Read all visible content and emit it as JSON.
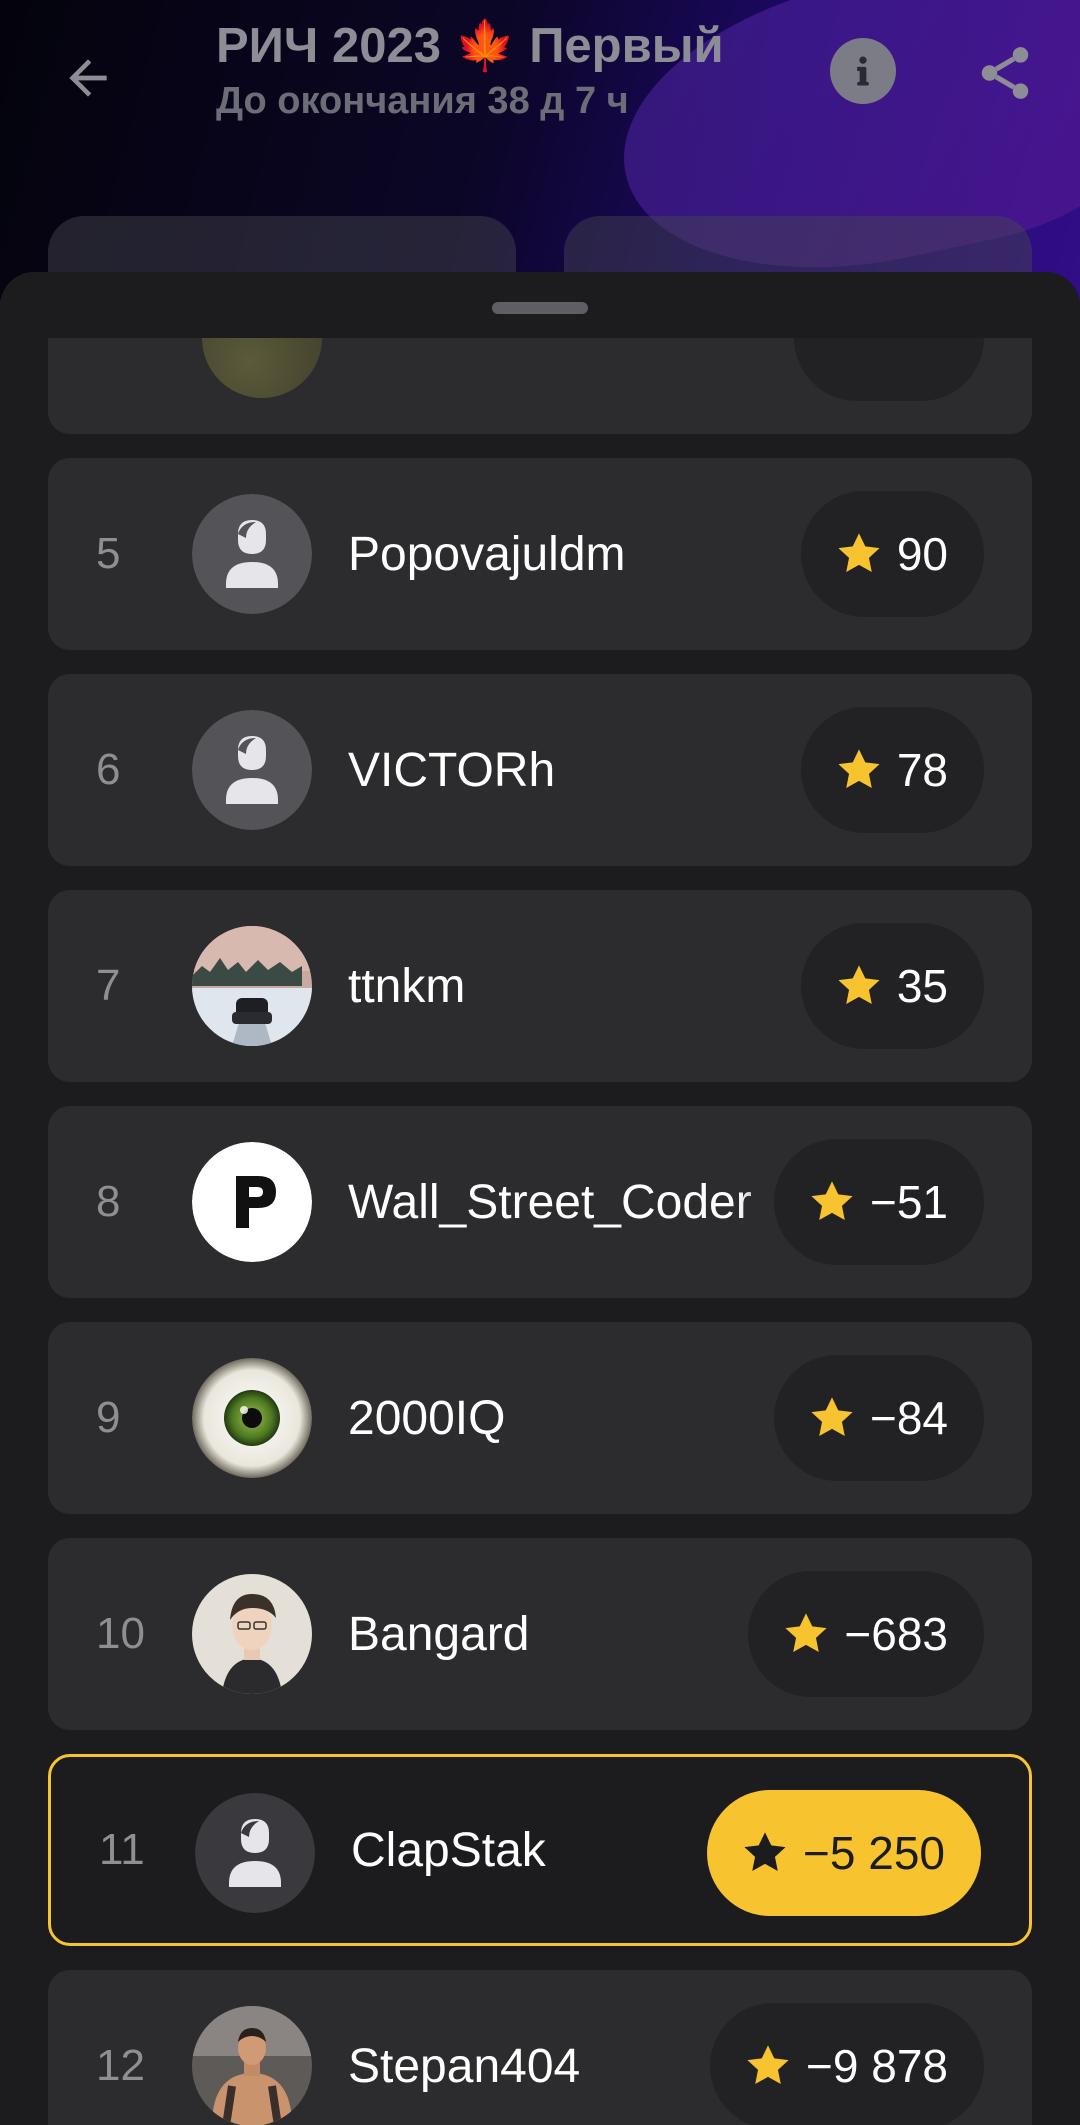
{
  "header": {
    "title": "РИЧ 2023 🍁 Первый",
    "subtitle": "До окончания 38 д 7 ч",
    "back_icon": "arrow-back-icon",
    "info_icon": "info-icon",
    "share_icon": "share-icon"
  },
  "colors": {
    "accent": "#f7c430",
    "card": "#2c2c2e",
    "background": "#1c1c1e"
  },
  "leaderboard": [
    {
      "rank": "5",
      "name": "Popovajuldm",
      "score": "90",
      "avatar": "default-user-icon"
    },
    {
      "rank": "6",
      "name": "VICTORh",
      "score": "78",
      "avatar": "default-user-icon"
    },
    {
      "rank": "7",
      "name": "ttnkm",
      "score": "35",
      "avatar": "photo-car-winter"
    },
    {
      "rank": "8",
      "name": "Wall_Street_Coder",
      "score": "−51",
      "avatar": "letter-p-logo"
    },
    {
      "rank": "9",
      "name": "2000IQ",
      "score": "−84",
      "avatar": "photo-eye"
    },
    {
      "rank": "10",
      "name": "Bangard",
      "score": "−683",
      "avatar": "photo-anime-man"
    },
    {
      "rank": "11",
      "name": "ClapStak",
      "score": "−5 250",
      "avatar": "default-user-icon",
      "is_current_user": true
    },
    {
      "rank": "12",
      "name": "Stepan404",
      "score": "−9 878",
      "avatar": "photo-bodybuilder"
    }
  ]
}
